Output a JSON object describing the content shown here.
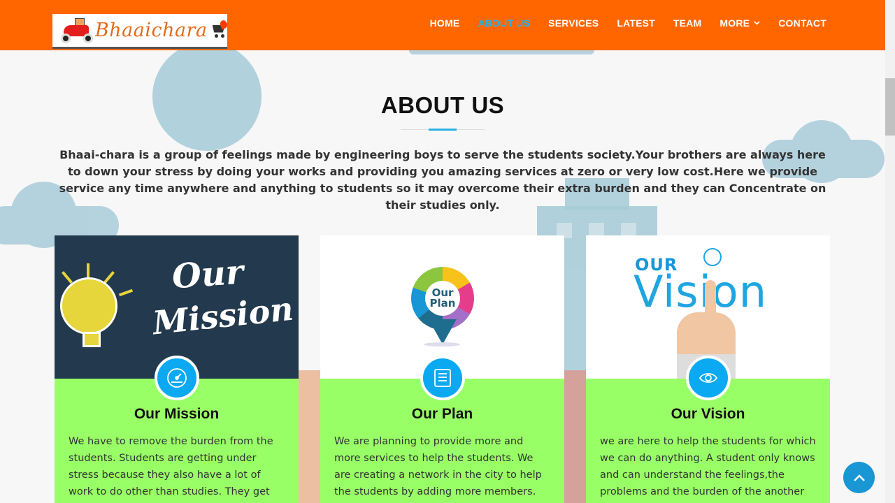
{
  "header": {
    "logo_text": "Bhaaichara",
    "nav": [
      {
        "label": "HOME"
      },
      {
        "label": "ABOUT US",
        "active": true
      },
      {
        "label": "SERVICES"
      },
      {
        "label": "LATEST"
      },
      {
        "label": "TEAM"
      },
      {
        "label": "MORE",
        "dropdown": true
      },
      {
        "label": "CONTACT"
      }
    ]
  },
  "about": {
    "title": "ABOUT US",
    "intro": "Bhaai-chara is a group of feelings made by engineering boys to serve the students society.Your brothers are always here to down your stress by doing your works and providing you amazing services at zero or very low cost.Here we provide service any time anywhere and anything to students so it may overcome their extra burden and they can Concentrate on their studies only."
  },
  "cards": [
    {
      "title": "Our Mission",
      "icon": "speedometer-icon",
      "image_text_1": "Our",
      "image_text_2": "Mission",
      "text": "We have to remove the burden from the students. Students are getting under stress because they also have a lot of work to do other than studies. They get more tired due to"
    },
    {
      "title": "Our Plan",
      "icon": "list-icon",
      "image_text_1": "Our",
      "image_text_2": "Plan",
      "text": "We are planning to provide more and more services to help the students. We are creating a network in the city to help the students by adding more members. Our goal is to make a"
    },
    {
      "title": "Our Vision",
      "icon": "eye-icon",
      "image_text_1": "OUR",
      "image_text_2": "Vision",
      "text": "we are here to help the students for which we can do anything. A student only knows and can understand the feelings,the problems and the burden of the another student. We need more"
    }
  ],
  "colors": {
    "header_bg": "#ff6600",
    "accent": "#29b3e6",
    "card_bg": "#99ff66",
    "icon_bg": "#0aa9f2"
  }
}
